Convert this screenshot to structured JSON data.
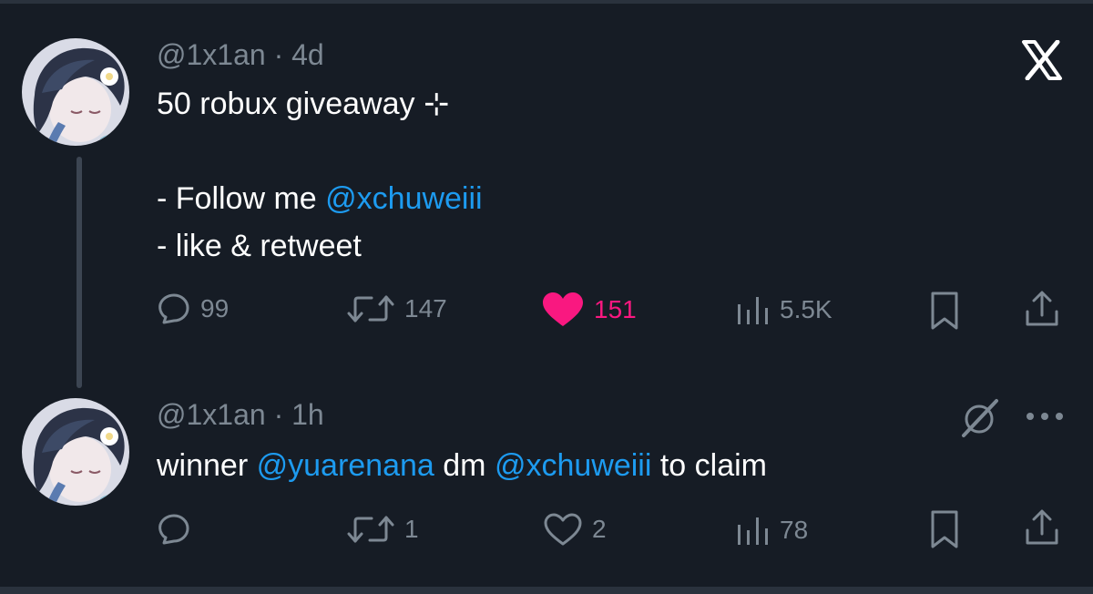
{
  "colors": {
    "background": "#161c25",
    "muted": "#7d8893",
    "mention": "#1d9bf0",
    "like": "#f91880",
    "text": "#ffffff"
  },
  "brand": {
    "icon": "x-logo-icon"
  },
  "tweet1": {
    "handle": "@1x1an",
    "time": "4d",
    "text_line1": "50 robux giveaway ⊹",
    "text_line2_prefix": "- Follow me ",
    "text_line2_mention": "@xchuweiii",
    "text_line3": "- like & retweet",
    "replies": "99",
    "retweets": "147",
    "likes": "151",
    "views": "5.5K",
    "liked": true
  },
  "tweet2": {
    "handle": "@1x1an",
    "time": "1h",
    "text_part1": "winner ",
    "mention1": "@yuarenana",
    "text_part2": " dm ",
    "mention2": "@xchuweiii",
    "text_part3": " to claim",
    "replies": "",
    "retweets": "1",
    "likes": "2",
    "views": "78",
    "liked": false
  }
}
